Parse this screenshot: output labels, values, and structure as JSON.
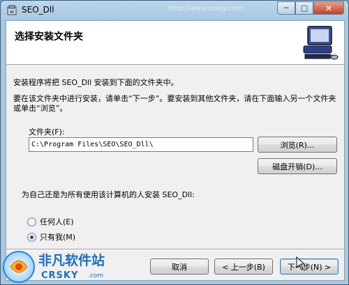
{
  "window": {
    "title": "SEO_Dll",
    "watermark_url": "http://www.crsky.com",
    "min_glyph": "─",
    "max_glyph": "□",
    "close_glyph": "✕"
  },
  "header": {
    "title": "选择安装文件夹"
  },
  "body": {
    "description_1": "安装程序将把 SEO_Dll 安装到下面的文件夹中。",
    "description_2": "要在该文件夹中进行安装，请单击“下一步”。要安装到其他文件夹，请在下面输入另一个文件夹或单击“浏览”。",
    "folder_label": "文件夹(F):",
    "folder_value": "C:\\Program Files\\SEO\\SEO_Dll\\",
    "browse_label": "浏览(R)...",
    "disk_cost_label": "磁盘开销(D)...",
    "install_for_label": "为自己还是为所有使用该计算机的人安装 SEO_Dll:",
    "radio_everyone": "任何人(E)",
    "radio_just_me": "只有我(M)",
    "selected_option": "just_me"
  },
  "footer": {
    "cancel_label": "取消",
    "back_label": "< 上一步(B)",
    "next_label": "下一步(N) >"
  },
  "logo": {
    "text": "非凡软件站",
    "sub": "CRSKY",
    "url": ".com"
  },
  "colors": {
    "accent": "#1b6fc0",
    "title_bar": "#a8c7e0",
    "dialog_bg": "#f0f0f0"
  }
}
